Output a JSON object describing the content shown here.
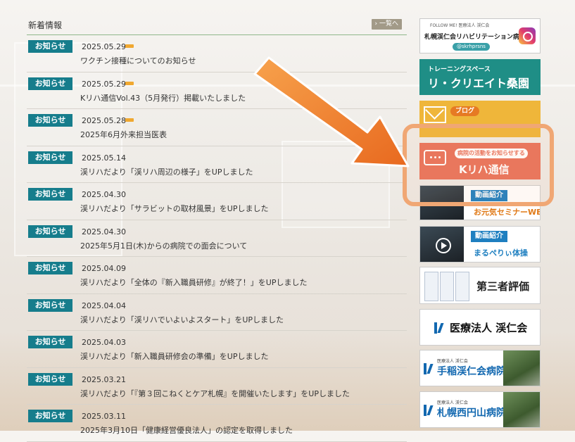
{
  "news": {
    "title": "新着情報",
    "more_label": "› 一覧へ",
    "items": [
      {
        "category": "お知らせ",
        "date": "2025.05.29",
        "is_new": true,
        "headline": "ワクチン接種についてのお知らせ"
      },
      {
        "category": "お知らせ",
        "date": "2025.05.29",
        "is_new": true,
        "headline": "Kリハ通信Vol.43（5月発行）掲載いたしました"
      },
      {
        "category": "お知らせ",
        "date": "2025.05.28",
        "is_new": true,
        "headline": "2025年6月外来担当医表"
      },
      {
        "category": "お知らせ",
        "date": "2025.05.14",
        "is_new": false,
        "headline": "渓リハだより「渓リハ周辺の様子」をUPしました"
      },
      {
        "category": "お知らせ",
        "date": "2025.04.30",
        "is_new": false,
        "headline": "渓リハだより「サラビットの取材風景」をUPしました"
      },
      {
        "category": "お知らせ",
        "date": "2025.04.30",
        "is_new": false,
        "headline": "2025年5月1日(木)からの病院での面会について"
      },
      {
        "category": "お知らせ",
        "date": "2025.04.09",
        "is_new": false,
        "headline": "渓リハだより「全体の『新入職員研修』が終了！」をUPしました"
      },
      {
        "category": "お知らせ",
        "date": "2025.04.04",
        "is_new": false,
        "headline": "渓リハだより「渓リハでいよいよスタート」をUPしました"
      },
      {
        "category": "お知らせ",
        "date": "2025.04.03",
        "is_new": false,
        "headline": "渓リハだより「新入職員研修会の準備」をUPしました"
      },
      {
        "category": "お知らせ",
        "date": "2025.03.21",
        "is_new": false,
        "headline": "渓リハだより「『第３回こねくとケア札幌』を開催いたします」をUPしました"
      },
      {
        "category": "お知らせ",
        "date": "2025.03.11",
        "is_new": false,
        "headline": "2025年3月10日「健康経営優良法人」の認定を取得しました"
      }
    ]
  },
  "banners": {
    "follow": {
      "small": "FOLLOW ME! 医療法人 渓仁会",
      "main": "札幌渓仁会リハビリテーション病院",
      "handle": "@skrhprsns",
      "icon": "instagram-icon"
    },
    "training": {
      "sub": "トレーニングスペース",
      "main": "リ・クリエイト桑園"
    },
    "blog": {
      "tag": "ブログ",
      "icon": "mail-icon"
    },
    "kriha": {
      "sub": "病院の活動をお知らせする",
      "main": "Kリハ通信",
      "icon": "chat-icon"
    },
    "video1": {
      "label": "動画紹介",
      "title": "お元気セミナーWEB"
    },
    "video2": {
      "label": "動画紹介",
      "title": "まるぺりぃ体操"
    },
    "evaluation": {
      "title": "第三者評価"
    },
    "corporation": {
      "title": "医療法人 渓仁会"
    },
    "hospital1": {
      "small": "医療法人 渓仁会",
      "name": "手稲渓仁会病院"
    },
    "hospital2": {
      "small": "医療法人 渓仁会",
      "name": "札幌西円山病院"
    }
  },
  "colors": {
    "badge": "#167d8c",
    "highlight": "#f0a774",
    "arrow": "#ef7f2f",
    "kriha": "#e9735c"
  }
}
